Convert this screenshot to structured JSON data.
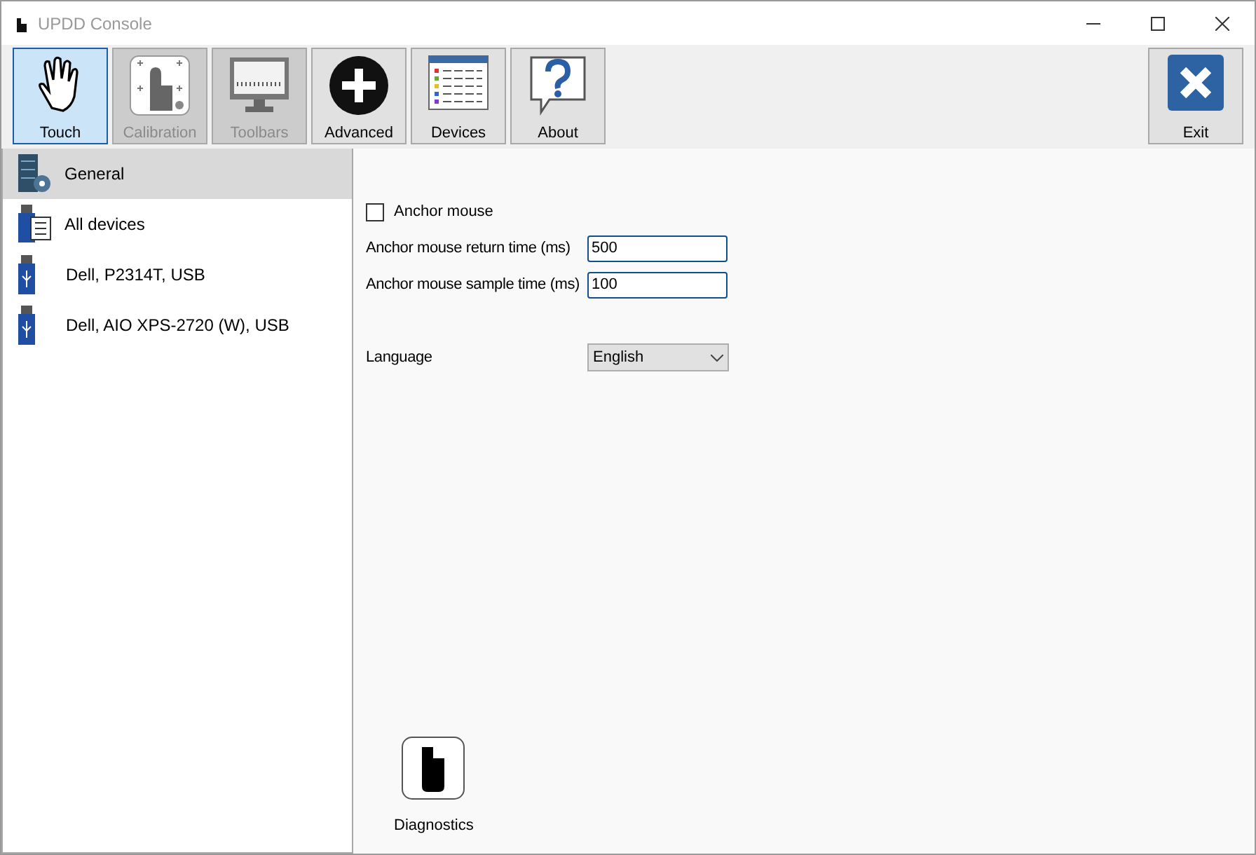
{
  "window": {
    "title": "UPDD Console"
  },
  "toolbar": [
    {
      "kind": "touch",
      "label": "Touch",
      "selected": true,
      "disabled": false
    },
    {
      "kind": "calibration",
      "label": "Calibration",
      "selected": false,
      "disabled": true
    },
    {
      "kind": "toolbars",
      "label": "Toolbars",
      "selected": false,
      "disabled": true
    },
    {
      "kind": "advanced",
      "label": "Advanced",
      "selected": false,
      "disabled": false
    },
    {
      "kind": "devices",
      "label": "Devices",
      "selected": false,
      "disabled": false
    },
    {
      "kind": "about",
      "label": "About",
      "selected": false,
      "disabled": false
    }
  ],
  "exit_button": {
    "label": "Exit"
  },
  "sidebar": {
    "items": [
      {
        "kind": "general",
        "label": "General",
        "selected": true
      },
      {
        "kind": "all",
        "label": "All devices",
        "selected": false
      },
      {
        "kind": "usb",
        "label": "Dell, P2314T, USB",
        "selected": false
      },
      {
        "kind": "usb",
        "label": "Dell, AIO XPS-2720 (W), USB",
        "selected": false
      }
    ]
  },
  "settings": {
    "anchor_mouse": {
      "label": "Anchor mouse",
      "checked": false
    },
    "fields": [
      {
        "label": "Anchor mouse return time (ms)",
        "value": "500"
      },
      {
        "label": "Anchor mouse sample time (ms)",
        "value": "100"
      }
    ],
    "language": {
      "label": "Language",
      "value": "English"
    }
  },
  "diagnostics": {
    "label": "Diagnostics"
  }
}
